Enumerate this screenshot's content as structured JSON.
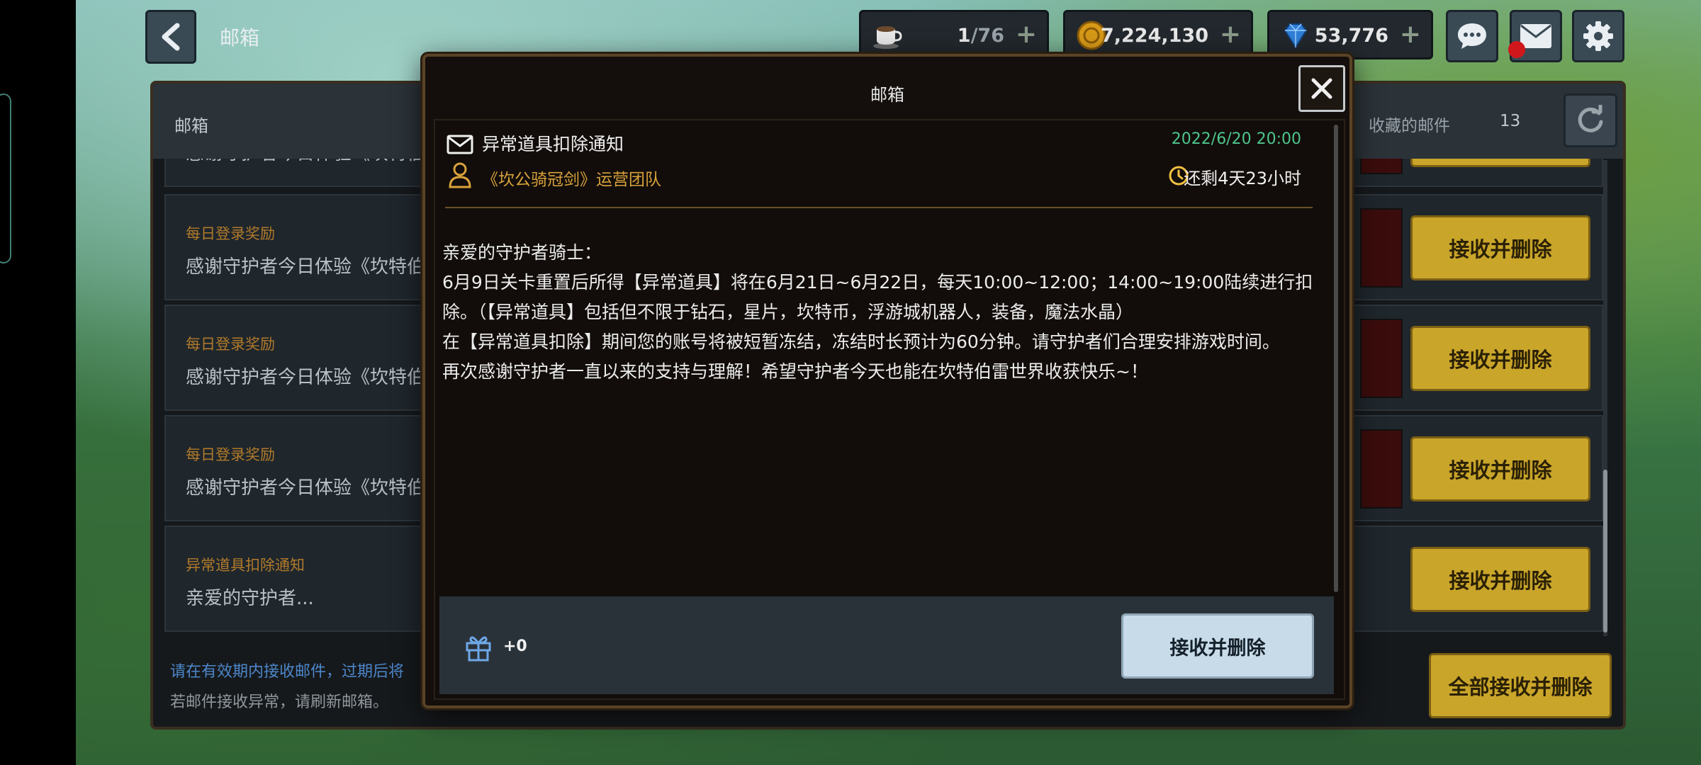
{
  "topbar": {
    "title": "邮箱",
    "stamina_current": "1",
    "stamina_max": "/76",
    "gold": "7,224,130",
    "gems": "53,776",
    "plus": "+"
  },
  "panel": {
    "title": "邮箱",
    "favorites_label": "收藏的邮件",
    "favorites_count": "13",
    "rows": [
      {
        "title": "",
        "body": "感谢守护者今日体验《坎特伯"
      },
      {
        "title": "每日登录奖励",
        "body": "感谢守护者今日体验《坎特伯"
      },
      {
        "title": "每日登录奖励",
        "body": "感谢守护者今日体验《坎特伯"
      },
      {
        "title": "每日登录奖励",
        "body": "感谢守护者今日体验《坎特伯"
      },
      {
        "title": "异常道具扣除通知",
        "body": "亲爱的守护者..."
      }
    ],
    "take_label": "接收并删除",
    "notice_line1": "请在有效期内接收邮件，过期后将",
    "notice_line2": "若邮件接收异常，请刷新邮箱。",
    "take_all_label": "全部接收并删除"
  },
  "modal": {
    "title": "邮箱",
    "subject": "异常道具扣除通知",
    "date": "2022/6/20 20:00",
    "sender": "《坎公骑冠剑》运营团队",
    "remaining": "还剩4天23小时",
    "body": [
      "亲爱的守护者骑士：",
      "6月9日关卡重置后所得【异常道具】将在6月21日~6月22日，每天10:00~12:00；14:00~19:00陆续进行扣除。（【异常道具】包括但不限于钻石，星片，坎特币，浮游城机器人，装备，魔法水晶）",
      "在【异常道具扣除】期间您的账号将被短暂冻结，冻结时长预计为60分钟。请守护者们合理安排游戏时间。",
      "再次感谢守护者一直以来的支持与理解！希望守护者今天也能在坎特伯雷世界收获快乐~！"
    ],
    "attachment_count": "+0",
    "take_label": "接收并删除"
  },
  "colors": {
    "accent_gold": "#c9a52a",
    "date_green": "#4ec58c",
    "sender_orange": "#d8a23c"
  },
  "icons": [
    "back-arrow-icon",
    "coffee-cup-icon",
    "gold-coin-icon",
    "gem-icon",
    "chat-icon",
    "mail-icon",
    "gear-icon",
    "refresh-icon",
    "close-icon",
    "envelope-icon",
    "user-icon",
    "clock-icon",
    "gift-icon"
  ]
}
